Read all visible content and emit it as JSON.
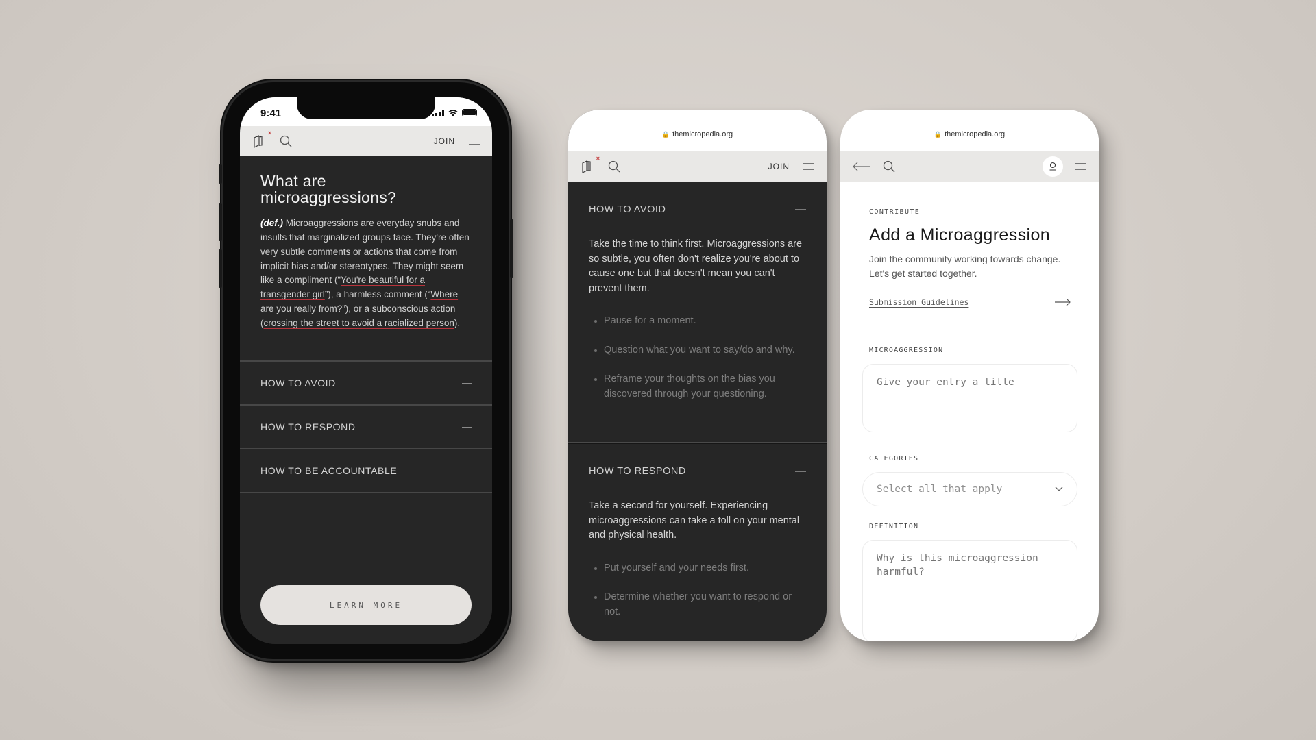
{
  "site": {
    "url": "themicropedia.org"
  },
  "phone1": {
    "status_time": "9:41",
    "nav": {
      "join_label": "JOIN"
    },
    "hero": {
      "title_line1": "What are",
      "title_line2": "microaggressions?",
      "def_tag": "(def.)",
      "body_1": " Microaggressions are everyday snubs and insults that marginalized groups face. They're often very subtle comments or actions that come from implicit bias and/or stereotypes. They might seem like a compliment (“",
      "example_1": "You're beautiful for a transgender girl",
      "body_2": "”), a harmless comment (“",
      "example_2": "Where are you really from",
      "body_3": "?”), or a subconscious action (",
      "example_3": "crossing the street to avoid a racialized person",
      "body_4": ")."
    },
    "accordion": [
      {
        "label": "HOW TO AVOID",
        "state": "collapsed"
      },
      {
        "label": "HOW TO RESPOND",
        "state": "collapsed"
      },
      {
        "label": "HOW TO BE ACCOUNTABLE",
        "state": "collapsed"
      }
    ],
    "learn_more_label": "LEARN MORE"
  },
  "phone2": {
    "nav": {
      "join_label": "JOIN"
    },
    "sections": [
      {
        "label": "HOW TO AVOID",
        "state": "expanded",
        "text": "Take the time to think first. Microaggressions are so subtle, you often don't realize you're about to cause one but that doesn't mean you can't prevent them.",
        "items": [
          "Pause for a moment.",
          "Question what you want to say/do and why.",
          "Reframe your thoughts on the bias you discovered through your questioning."
        ]
      },
      {
        "label": "HOW TO RESPOND",
        "state": "expanded",
        "text": "Take a second for yourself. Experiencing microaggressions can take a toll on your mental and physical health.",
        "items": [
          "Put yourself and your needs first.",
          "Determine whether you want to respond or not."
        ]
      }
    ]
  },
  "phone3": {
    "eyebrow": "CONTRIBUTE",
    "title": "Add a Microaggression",
    "subtitle": "Join the community working towards change. Let's get started together.",
    "guidelines_link": "Submission Guidelines",
    "fields": {
      "microaggression": {
        "label": "MICROAGGRESSION",
        "placeholder": "Give your entry a title",
        "value": ""
      },
      "categories": {
        "label": "CATEGORIES",
        "placeholder": "Select all that apply"
      },
      "definition": {
        "label": "DEFINITION",
        "placeholder": "Why is this microaggression harmful?",
        "value": ""
      }
    }
  },
  "colors": {
    "dark_bg": "#262626",
    "nav_bg": "#e9e8e6",
    "accent_red": "#b8333b",
    "page_bg": "#d2ccc6"
  }
}
